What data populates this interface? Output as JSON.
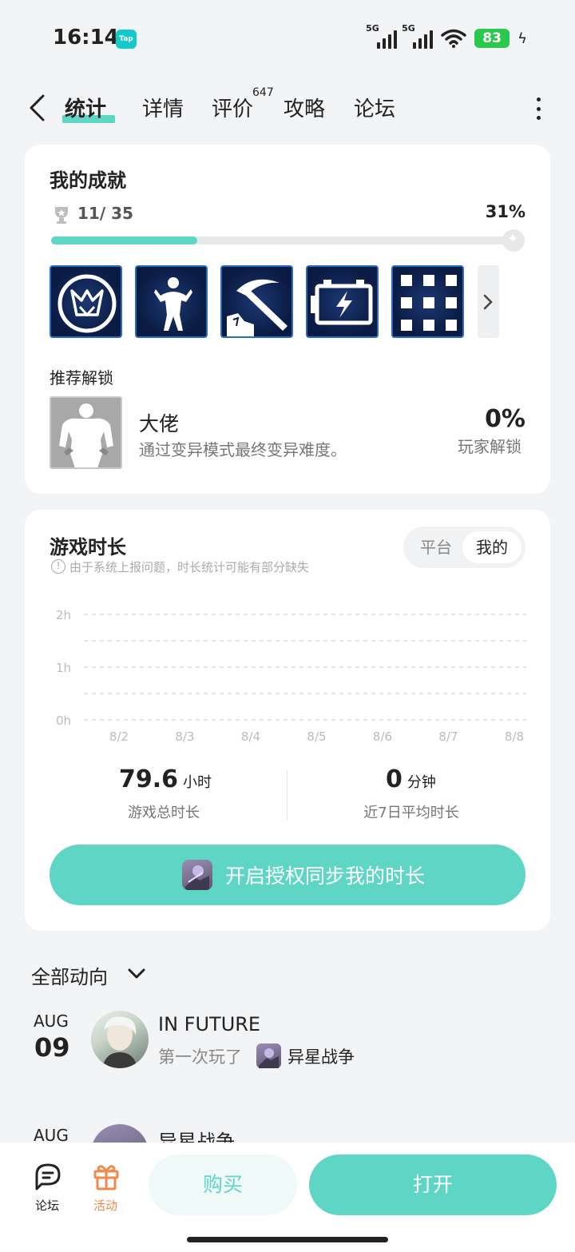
{
  "status_bar": {
    "time": "16:14",
    "app_badge": "Tap",
    "signal_1_label": "5G",
    "signal_2_label": "5G",
    "battery": "83"
  },
  "nav": {
    "tabs": [
      {
        "label": "统计",
        "active": true
      },
      {
        "label": "详情"
      },
      {
        "label": "评价",
        "count": "647"
      },
      {
        "label": "攻略"
      },
      {
        "label": "论坛"
      }
    ]
  },
  "achievements": {
    "title": "我的成就",
    "count": "11/ 35",
    "percent_text": "31%",
    "progress": 0.31,
    "badges": [
      {
        "icon": "crown-emblem-icon"
      },
      {
        "icon": "flexing-figure-icon"
      },
      {
        "icon": "pickaxe-icon"
      },
      {
        "icon": "battery-charge-icon"
      },
      {
        "icon": "grid-icon"
      }
    ],
    "recommended_title": "推荐解锁",
    "recommended": {
      "name": "大佬",
      "description": "通过变异模式最终变异难度。",
      "percent": "0%",
      "percent_label": "玩家解锁"
    }
  },
  "playtime": {
    "title": "游戏时长",
    "note": "由于系统上报问题，时长统计可能有部分缺失",
    "toggle": {
      "platform": "平台",
      "mine": "我的",
      "selected": "我的"
    },
    "total_value": "79.6",
    "total_unit": "小时",
    "total_label": "游戏总时长",
    "avg_value": "0",
    "avg_unit": "分钟",
    "avg_label": "近7日平均时长",
    "sync_button": "开启授权同步我的时长"
  },
  "chart_data": {
    "type": "bar",
    "categories": [
      "8/2",
      "8/3",
      "8/4",
      "8/5",
      "8/6",
      "8/7",
      "8/8"
    ],
    "values": [
      0,
      0,
      0,
      0,
      0,
      0,
      0
    ],
    "yticks": [
      "2h",
      "1h",
      "0h"
    ],
    "ylim": [
      0,
      2
    ],
    "grid": true
  },
  "feed": {
    "title": "全部动向",
    "items": [
      {
        "month": "AUG",
        "day": "09",
        "user": "IN  FUTURE",
        "action": "第一次玩了",
        "game": "异星战争"
      },
      {
        "month": "AUG",
        "user": "异星战争"
      }
    ]
  },
  "bottom_bar": {
    "forum_label": "论坛",
    "activity_label": "活动",
    "buy_label": "购买",
    "open_label": "打开",
    "accent_color": "#5fd5c6",
    "activity_color": "#f08a4b"
  }
}
